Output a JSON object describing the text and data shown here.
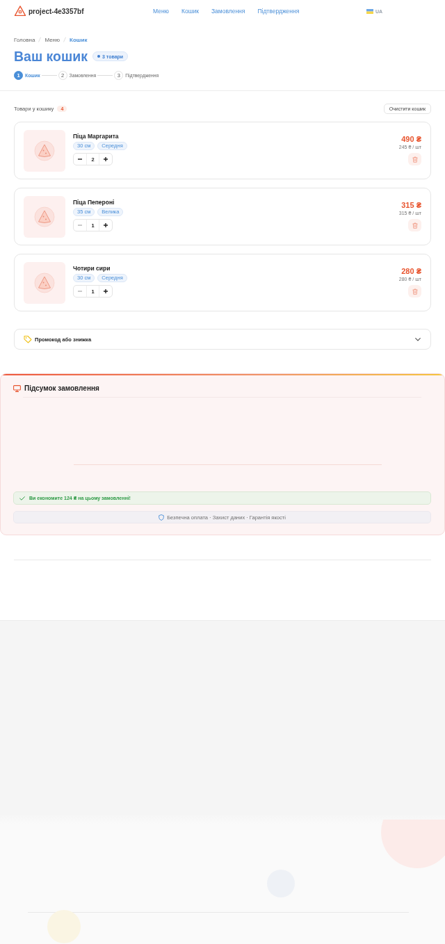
{
  "header": {
    "logo": "project-4e3357bf",
    "nav": [
      "Меню",
      "Кошик",
      "Замовлення",
      "Підтвердження"
    ],
    "language": "UA"
  },
  "breadcrumb": [
    {
      "label": "Головна",
      "selected": false
    },
    {
      "label": "Меню",
      "selected": false
    },
    {
      "label": "Кошик",
      "selected": true
    }
  ],
  "page": {
    "title": "Ваш кошик",
    "badge": "3 товари"
  },
  "steps": [
    {
      "number": "1",
      "label": "Кошик",
      "selected": true
    },
    {
      "number": "2",
      "label": "Замовлення",
      "selected": false
    },
    {
      "number": "3",
      "label": "Підтвердження",
      "selected": false
    }
  ],
  "cart": {
    "title": "Товари у кошику",
    "count": "4",
    "clear_button": "Очистити кошик"
  },
  "items": [
    {
      "name": "Піца Маргарита",
      "tags": [
        "30 см",
        "Середня"
      ],
      "quantity": "2",
      "decrease_disabled": false,
      "price": "490 ₴",
      "unit_price": "245 ₴ / шт"
    },
    {
      "name": "Піца Пепероні",
      "tags": [
        "35 см",
        "Велика"
      ],
      "quantity": "1",
      "decrease_disabled": true,
      "price": "315 ₴",
      "unit_price": "315 ₴ / шт"
    },
    {
      "name": "Чотири сири",
      "tags": [
        "30 см",
        "Середня"
      ],
      "quantity": "1",
      "decrease_disabled": true,
      "price": "280 ₴",
      "unit_price": "280 ₴ / шт"
    }
  ],
  "promo": {
    "label": "Промокод або знижка",
    "expanded": false
  },
  "summary": {
    "title": "Підсумок замовлення",
    "savings": "Ви економите 124 ₴ на цьому замовленні!",
    "security": "Безпечна оплата · Захист даних · Гарантія якості"
  }
}
